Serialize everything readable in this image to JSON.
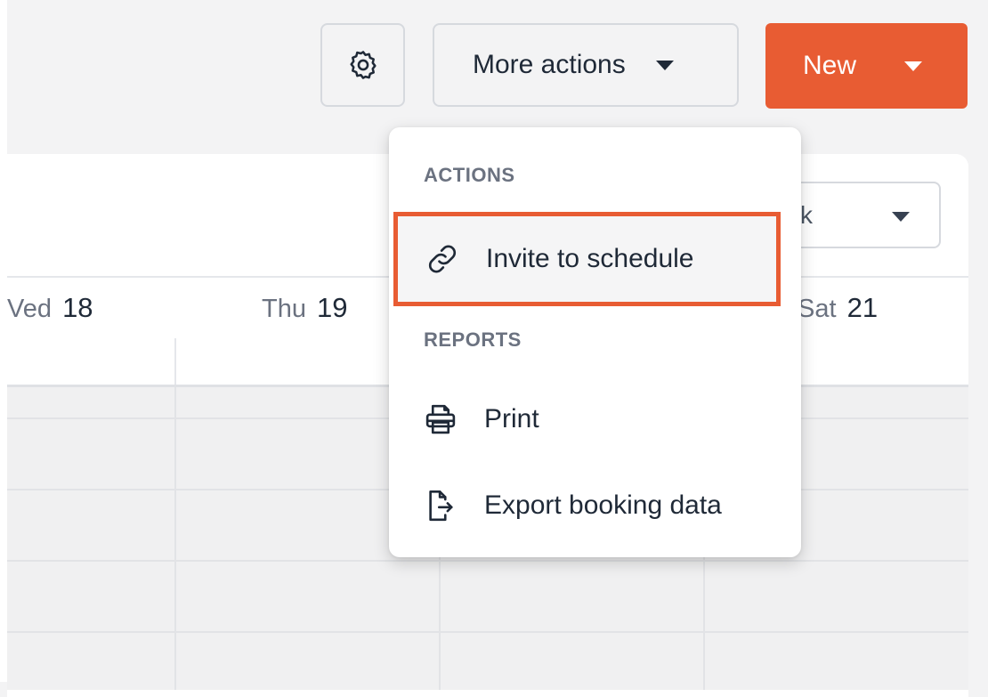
{
  "toolbar": {
    "settings_icon": "gear-icon",
    "more_actions_label": "More actions",
    "new_label": "New",
    "accent_color": "#e85c33"
  },
  "calendar": {
    "view_select_value": "k",
    "days": [
      {
        "name": "Ved",
        "num": "18"
      },
      {
        "name": "Thu",
        "num": "19"
      },
      {
        "name": "Sat",
        "num": "21"
      }
    ]
  },
  "menu": {
    "sections": [
      {
        "label": "ACTIONS",
        "items": [
          {
            "label": "Invite to schedule",
            "icon": "link-icon",
            "highlighted": true
          }
        ]
      },
      {
        "label": "REPORTS",
        "items": [
          {
            "label": "Print",
            "icon": "printer-icon"
          },
          {
            "label": "Export booking data",
            "icon": "export-file-icon"
          }
        ]
      }
    ]
  }
}
